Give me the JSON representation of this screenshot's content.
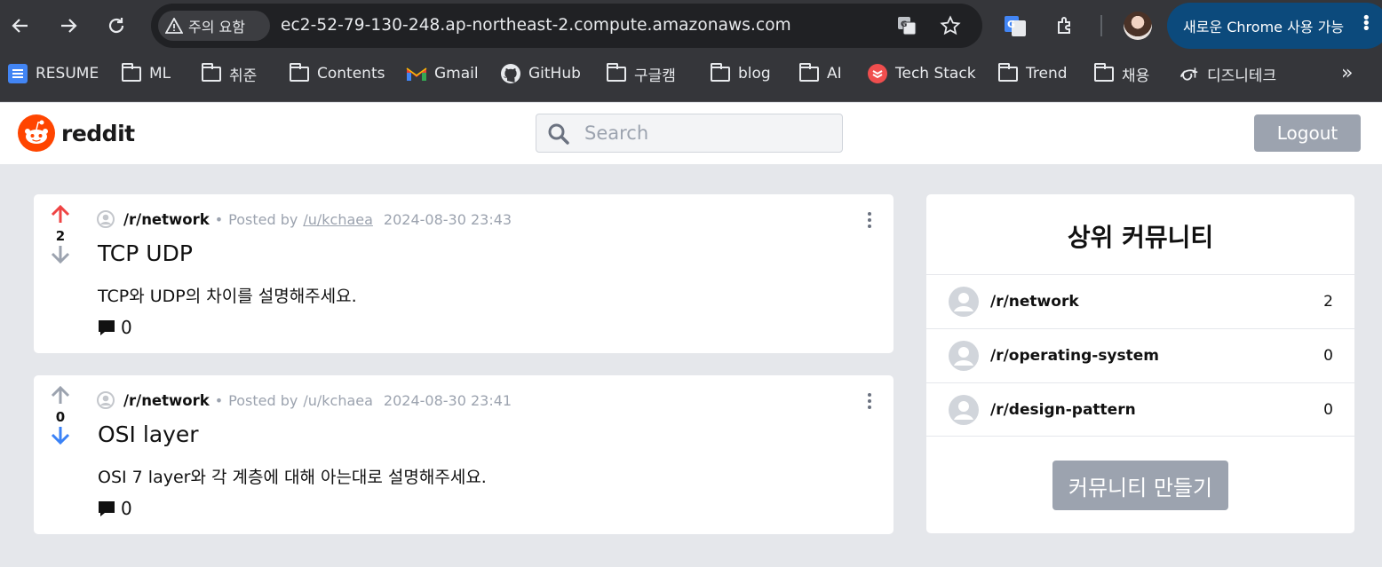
{
  "browser": {
    "security_label": "주의 요함",
    "url": "ec2-52-79-130-248.ap-northeast-2.compute.amazonaws.com",
    "update_label": "새로운 Chrome 사용 가능"
  },
  "bookmarks": [
    {
      "label": "RESUME",
      "icon": "docs-icon"
    },
    {
      "label": "ML",
      "icon": "folder-icon"
    },
    {
      "label": "취준",
      "icon": "folder-icon"
    },
    {
      "label": "Contents",
      "icon": "folder-icon"
    },
    {
      "label": "Gmail",
      "icon": "gmail-icon"
    },
    {
      "label": "GitHub",
      "icon": "github-icon"
    },
    {
      "label": "구글캠",
      "icon": "folder-icon"
    },
    {
      "label": "blog",
      "icon": "folder-icon"
    },
    {
      "label": "AI",
      "icon": "folder-icon"
    },
    {
      "label": "Tech Stack",
      "icon": "techstack-icon"
    },
    {
      "label": "Trend",
      "icon": "folder-icon"
    },
    {
      "label": "채용",
      "icon": "folder-icon"
    },
    {
      "label": "디즈니테크",
      "icon": "disney-icon"
    }
  ],
  "app": {
    "logo_text": "reddit",
    "search_placeholder": "Search",
    "logout_label": "Logout"
  },
  "posts": [
    {
      "votes": "2",
      "vote_state": "up",
      "subreddit": "/r/network",
      "posted_by_label": "Posted by",
      "author": "/u/kchaea",
      "timestamp": "2024-08-30 23:43",
      "title": "TCP UDP",
      "body": "TCP와 UDP의 차이를 설명해주세요.",
      "comments": "0"
    },
    {
      "votes": "0",
      "vote_state": "down",
      "subreddit": "/r/network",
      "posted_by_label": "Posted by",
      "author": "/u/kchaea",
      "timestamp": "2024-08-30 23:41",
      "title": "OSI layer",
      "body": "OSI 7 layer와 각 계층에 대해 아는대로 설명해주세요.",
      "comments": "0"
    }
  ],
  "sidebar": {
    "title": "상위 커뮤니티",
    "communities": [
      {
        "name": "/r/network",
        "count": "2"
      },
      {
        "name": "/r/operating-system",
        "count": "0"
      },
      {
        "name": "/r/design-pattern",
        "count": "0"
      }
    ],
    "create_label": "커뮤니티 만들기"
  },
  "colors": {
    "upvote_active": "#ef4444",
    "downvote_active": "#3b82f6",
    "vote_inactive": "#9ca3af",
    "reddit_orange": "#ff4500",
    "update_pill": "#0c4a7c"
  }
}
